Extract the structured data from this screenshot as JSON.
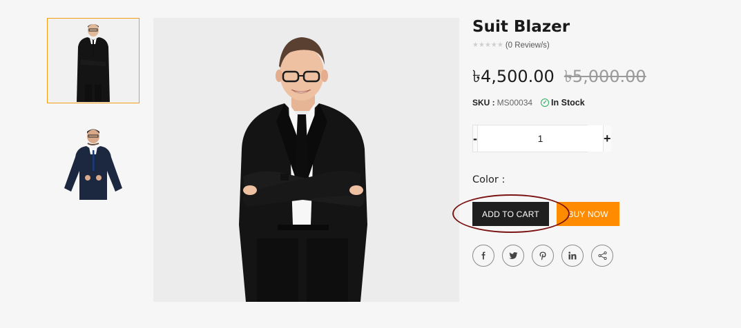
{
  "product": {
    "title": "Suit Blazer",
    "reviews_text": "(0 Review/s)",
    "price_current": "৳4,500.00",
    "price_old": "৳5,000.00",
    "sku_label": "SKU :",
    "sku_value": "MS00034",
    "stock_text": "In Stock",
    "quantity": "1",
    "color_label": "Color :"
  },
  "buttons": {
    "qty_minus": "-",
    "qty_plus": "+",
    "add_to_cart": "ADD TO CART",
    "buy_now": "BUY NOW"
  },
  "social": [
    {
      "name": "facebook-icon",
      "glyph": "f"
    },
    {
      "name": "twitter-icon",
      "glyph": "t"
    },
    {
      "name": "pinterest-icon",
      "glyph": "p"
    },
    {
      "name": "linkedin-icon",
      "glyph": "in"
    },
    {
      "name": "share-icon",
      "glyph": "share"
    }
  ],
  "colors": {
    "accent": "#ff8c00",
    "cart_button": "#1f1f1f",
    "thumb_border": "#f39c12",
    "stock_ok": "#27ae60",
    "highlight": "#7a1212"
  },
  "rating": {
    "stars": 5,
    "filled": 0
  }
}
